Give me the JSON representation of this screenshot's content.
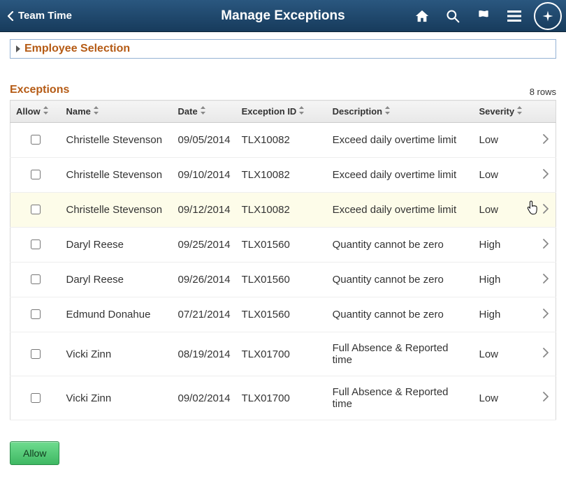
{
  "header": {
    "back_label": "Team Time",
    "title": "Manage Exceptions"
  },
  "groupbox": {
    "title": "Employee Selection"
  },
  "exceptions": {
    "title": "Exceptions",
    "rows_label": "8 rows",
    "columns": {
      "allow": "Allow",
      "name": "Name",
      "date": "Date",
      "exception_id": "Exception ID",
      "description": "Description",
      "severity": "Severity"
    },
    "rows": [
      {
        "name": "Christelle Stevenson",
        "date": "09/05/2014",
        "exc": "TLX10082",
        "desc": "Exceed daily overtime limit",
        "sev": "Low",
        "hl": false
      },
      {
        "name": "Christelle Stevenson",
        "date": "09/10/2014",
        "exc": "TLX10082",
        "desc": "Exceed daily overtime limit",
        "sev": "Low",
        "hl": false
      },
      {
        "name": "Christelle Stevenson",
        "date": "09/12/2014",
        "exc": "TLX10082",
        "desc": "Exceed daily overtime limit",
        "sev": "Low",
        "hl": true
      },
      {
        "name": "Daryl Reese",
        "date": "09/25/2014",
        "exc": "TLX01560",
        "desc": "Quantity cannot be zero",
        "sev": "High",
        "hl": false
      },
      {
        "name": "Daryl Reese",
        "date": "09/26/2014",
        "exc": "TLX01560",
        "desc": "Quantity cannot be zero",
        "sev": "High",
        "hl": false
      },
      {
        "name": "Edmund Donahue",
        "date": "07/21/2014",
        "exc": "TLX01560",
        "desc": "Quantity cannot be zero",
        "sev": "High",
        "hl": false
      },
      {
        "name": "Vicki Zinn",
        "date": "08/19/2014",
        "exc": "TLX01700",
        "desc": "Full Absence & Reported time",
        "sev": "Low",
        "hl": false
      },
      {
        "name": "Vicki Zinn",
        "date": "09/02/2014",
        "exc": "TLX01700",
        "desc": "Full Absence & Reported time",
        "sev": "Low",
        "hl": false
      }
    ]
  },
  "buttons": {
    "allow": "Allow"
  }
}
